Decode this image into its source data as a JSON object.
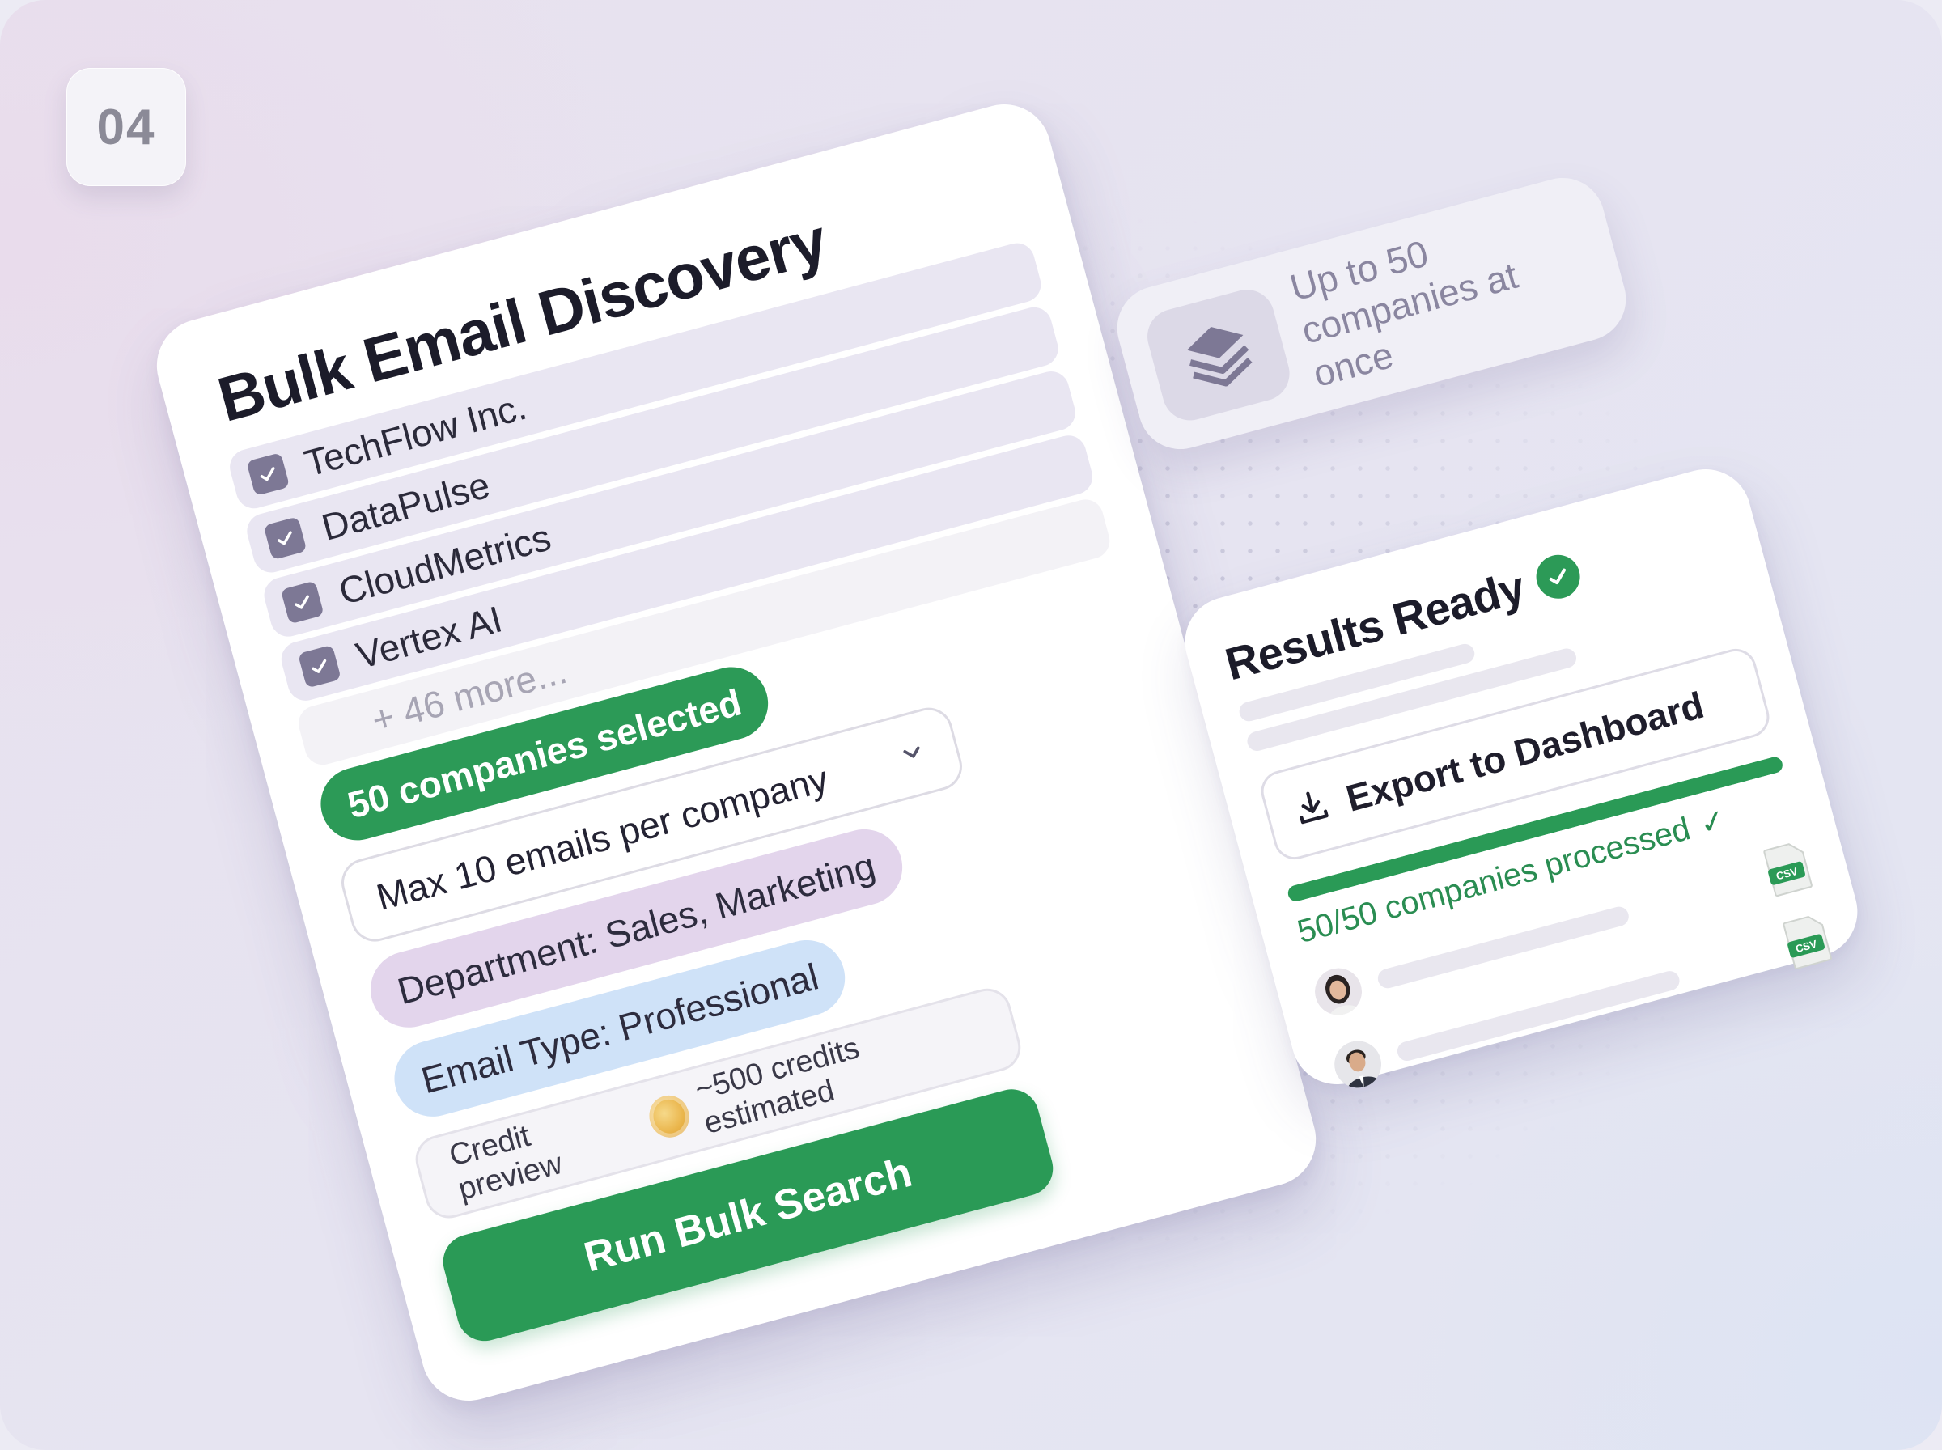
{
  "step": {
    "number": "04"
  },
  "bulk": {
    "title": "Bulk Email Discovery",
    "companies": [
      {
        "name": "TechFlow Inc.",
        "checked": true
      },
      {
        "name": "DataPulse",
        "checked": true
      },
      {
        "name": "CloudMetrics",
        "checked": true
      },
      {
        "name": "Vertex AI",
        "checked": true
      }
    ],
    "more_label": "+ 46 more...",
    "selected_label": "50 companies selected",
    "max_emails": {
      "value": "Max 10 emails per company",
      "icon": "chevron-down-icon"
    },
    "department_tag": "Department: Sales, Marketing",
    "email_type_tag": "Email Type: Professional",
    "credit_preview": {
      "label": "Credit preview",
      "estimate": "~500 credits estimated",
      "icon": "coin-icon"
    },
    "run_button": "Run Bulk Search"
  },
  "info": {
    "text": "Up to 50 companies at once",
    "icon": "layers-icon"
  },
  "results": {
    "title": "Results Ready",
    "export_button": "Export to Dashboard",
    "progress": 1.0,
    "processed": "50/50 companies processed",
    "csv_label": "CSV",
    "colors": {
      "accent": "#2a9a56",
      "accent_light": "#dff0e6",
      "muted": "#8a86a0"
    }
  }
}
